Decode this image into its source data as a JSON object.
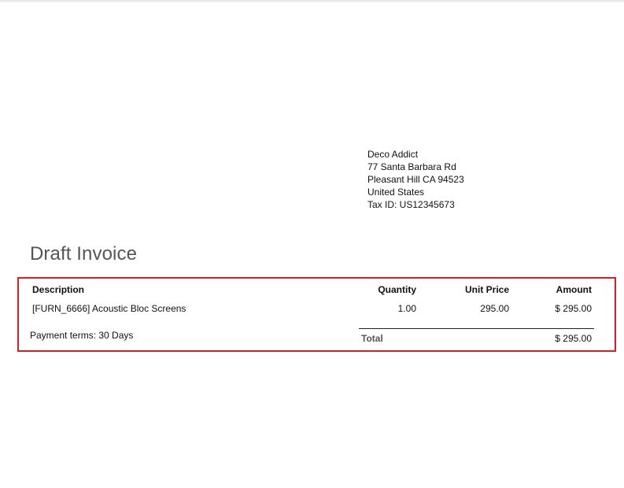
{
  "partner": {
    "name": "Deco Addict",
    "street": "77 Santa Barbara Rd",
    "city_line": "Pleasant Hill CA 94523",
    "country": "United States",
    "tax_id": "Tax ID: US12345673"
  },
  "document": {
    "title": "Draft Invoice"
  },
  "table": {
    "headers": {
      "description": "Description",
      "quantity": "Quantity",
      "unit_price": "Unit Price",
      "amount": "Amount"
    },
    "rows": [
      {
        "description": "[FURN_6666] Acoustic Bloc Screens",
        "quantity": "1.00",
        "unit_price": "295.00",
        "amount": "$ 295.00"
      }
    ]
  },
  "payment_terms": "Payment terms: 30 Days",
  "totals": {
    "label": "Total",
    "value": "$ 295.00"
  },
  "colors": {
    "highlight_border": "#e01b24",
    "title": "#555555"
  }
}
